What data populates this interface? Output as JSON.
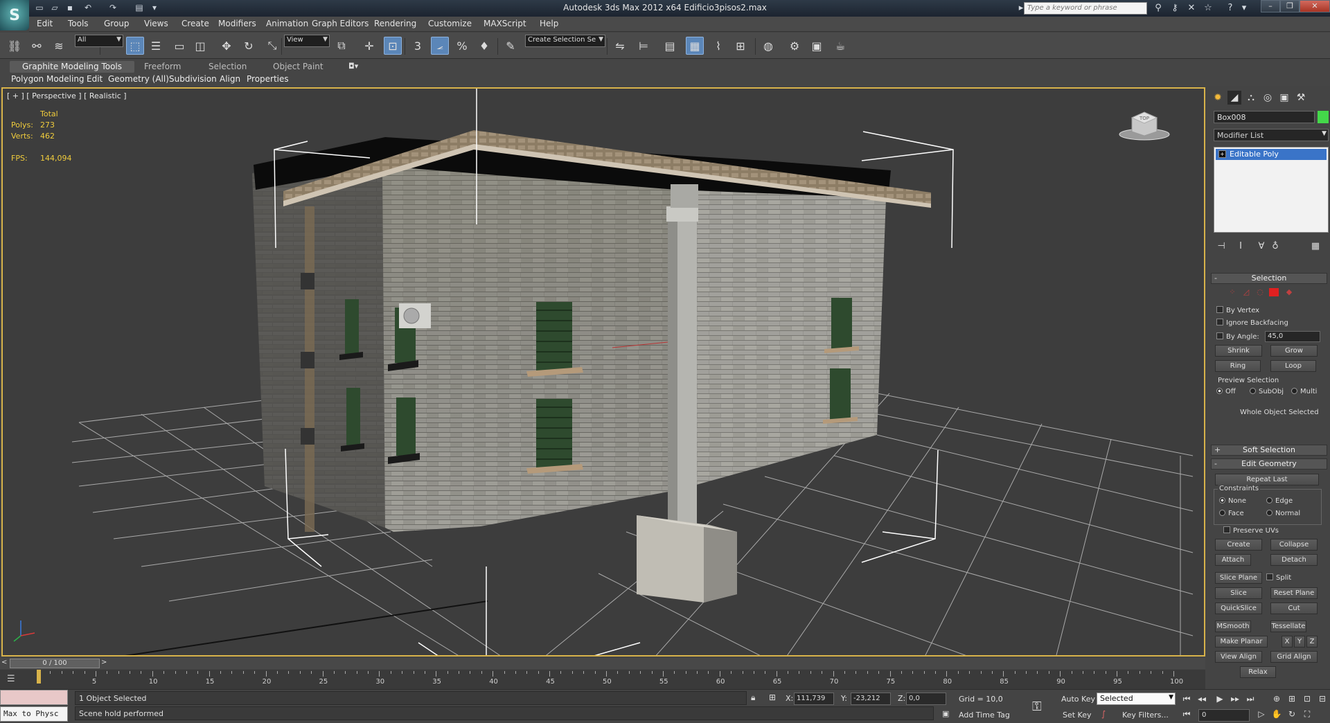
{
  "app": {
    "logo": "S",
    "window_title": "Autodesk 3ds Max  2012 x64      Edificio3pisos2.max",
    "search_placeholder": "Type a keyword or phrase"
  },
  "menu": [
    "Edit",
    "Tools",
    "Group",
    "Views",
    "Create",
    "Modifiers",
    "Animation",
    "Graph Editors",
    "Rendering",
    "Customize",
    "MAXScript",
    "Help"
  ],
  "toolbar": {
    "selection_filter": "All",
    "ref_coord": "View",
    "named_selection_placeholder": "Create Selection Se",
    "snap_labels": {
      "snap": "3",
      "angle": "⦟",
      "percent": "%",
      "spinner": "♦"
    }
  },
  "ribbon": {
    "tabs": [
      "Graphite Modeling Tools",
      "Freeform",
      "Selection",
      "Object Paint"
    ],
    "subtabs": [
      "Polygon Modeling",
      "Edit",
      "Geometry (All)",
      "Subdivision",
      "Align",
      "Properties"
    ]
  },
  "viewport": {
    "label": "[ + ] [ Perspective ] [ Realistic ]",
    "stats_header": "Total",
    "polys_label": "Polys:",
    "polys_value": "273",
    "verts_label": "Verts:",
    "verts_value": "462",
    "fps_label": "FPS:",
    "fps_value": "144,094",
    "viewcube_label": "TOP"
  },
  "command_panel": {
    "object_name": "Box008",
    "object_color": "#44d84a",
    "modifier_list": "Modifier List",
    "stack_item": "Editable Poly",
    "selection_header": "Selection",
    "by_vertex": "By Vertex",
    "ignore_backfacing": "Ignore Backfacing",
    "by_angle": "By Angle:",
    "by_angle_value": "45,0",
    "shrink": "Shrink",
    "grow": "Grow",
    "ring": "Ring",
    "loop": "Loop",
    "preview_selection": "Preview Selection",
    "preview_off": "Off",
    "preview_subobj": "SubObj",
    "preview_multi": "Multi",
    "whole_object": "Whole Object Selected",
    "soft_selection": "Soft Selection",
    "edit_geometry": "Edit Geometry",
    "repeat_last": "Repeat Last",
    "constraints": "Constraints",
    "c_none": "None",
    "c_edge": "Edge",
    "c_face": "Face",
    "c_normal": "Normal",
    "preserve_uvs": "Preserve UVs",
    "create": "Create",
    "collapse": "Collapse",
    "attach": "Attach",
    "detach": "Detach",
    "slice_plane": "Slice Plane",
    "split": "Split",
    "slice": "Slice",
    "reset_plane": "Reset Plane",
    "quickslice": "QuickSlice",
    "cut": "Cut",
    "msmooth": "MSmooth",
    "tessellate": "Tessellate",
    "make_planar": "Make Planar",
    "axis_x": "X",
    "axis_y": "Y",
    "axis_z": "Z",
    "view_align": "View Align",
    "grid_align": "Grid Align",
    "relax": "Relax"
  },
  "timeline": {
    "slider_text": "0 / 100",
    "ticks": [
      "5",
      "10",
      "15",
      "20",
      "25",
      "30",
      "35",
      "40",
      "45",
      "50",
      "55",
      "60",
      "65",
      "70",
      "75",
      "80",
      "85",
      "90",
      "95",
      "100"
    ],
    "current_frame": 0,
    "frame_max": 100
  },
  "status": {
    "maxscript_listener": "Max to Physc",
    "selection_info": "1 Object Selected",
    "prompt": "Scene hold performed",
    "x_label": "X:",
    "x_value": "111,739",
    "y_label": "Y:",
    "y_value": "-23,212",
    "z_label": "Z:",
    "z_value": "0,0",
    "grid": "Grid = 10,0",
    "add_time_tag": "Add Time Tag",
    "auto_key": "Auto Key",
    "set_key": "Set Key",
    "set_key_filter": "Selected",
    "key_filters": "Key Filters...",
    "frame_value": "0"
  }
}
